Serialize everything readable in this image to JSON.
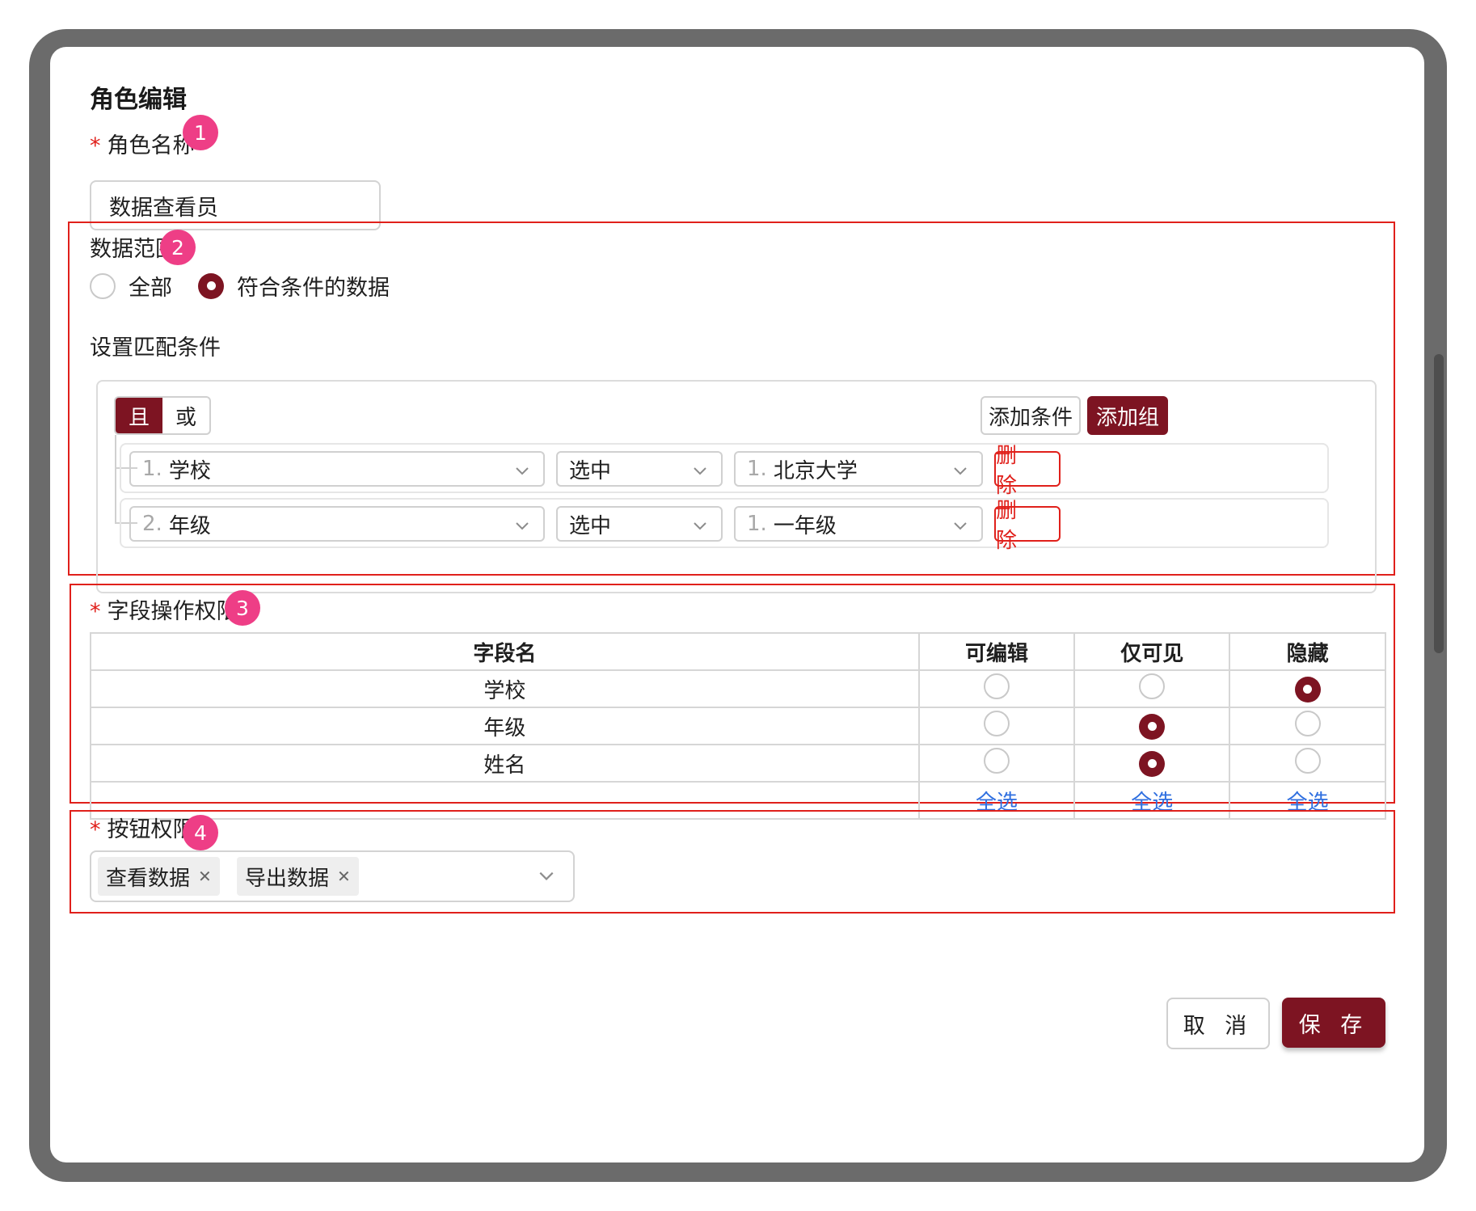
{
  "dialog": {
    "title": "角色编辑"
  },
  "role_name": {
    "label": "角色名称",
    "badge": "1",
    "value": "数据查看员"
  },
  "data_scope": {
    "label": "数据范围",
    "badge": "2",
    "options": [
      {
        "label": "全部",
        "selected": false
      },
      {
        "label": "符合条件的数据",
        "selected": true
      }
    ],
    "match_label": "设置匹配条件",
    "logic": {
      "and_label": "且",
      "or_label": "或",
      "selected": "且"
    },
    "add_condition_label": "添加条件",
    "add_group_label": "添加组",
    "conditions": [
      {
        "field_num": "1.",
        "field": "学校",
        "operator": "选中",
        "value_num": "1.",
        "value": "北京大学",
        "delete_label": "删 除"
      },
      {
        "field_num": "2.",
        "field": "年级",
        "operator": "选中",
        "value_num": "1.",
        "value": "一年级",
        "delete_label": "删 除"
      }
    ]
  },
  "field_permissions": {
    "label": "字段操作权限",
    "badge": "3",
    "headers": [
      "字段名",
      "可编辑",
      "仅可见",
      "隐藏"
    ],
    "rows": [
      {
        "field": "学校",
        "selected": "隐藏"
      },
      {
        "field": "年级",
        "selected": "仅可见"
      },
      {
        "field": "姓名",
        "selected": "仅可见"
      }
    ],
    "select_all_label": "全选"
  },
  "button_permissions": {
    "label": "按钮权限",
    "badge": "4",
    "tags": [
      "查看数据",
      "导出数据"
    ]
  },
  "footer": {
    "cancel_label": "取 消",
    "save_label": "保 存"
  },
  "colors": {
    "primary": "#7d1422",
    "highlight_border": "#e0201b",
    "badge": "#ee3e86",
    "link": "#2f6fe0"
  }
}
